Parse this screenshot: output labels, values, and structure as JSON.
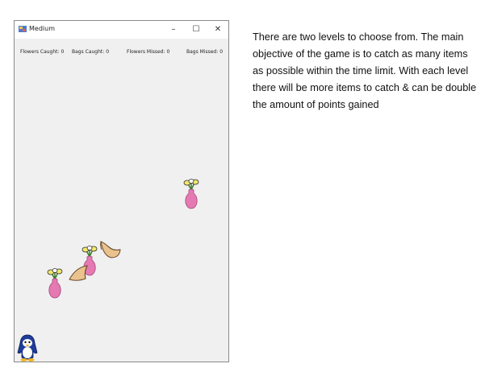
{
  "window": {
    "title": "Medium",
    "controls": {
      "minimize": "–",
      "maximize": "☐",
      "close": "✕"
    }
  },
  "stats": {
    "flowers_caught_label": "Flowers Caught:",
    "flowers_caught_value": "0",
    "bags_caught_label": "Bags Caught:",
    "bags_caught_value": "0",
    "flowers_missed_label": "Flowers Missed:",
    "flowers_missed_value": "0",
    "bags_missed_label": "Bags Missed:",
    "bags_missed_value": "0"
  },
  "game": {
    "items": [
      {
        "kind": "flower-vase-icon"
      },
      {
        "kind": "flower-vase-icon"
      },
      {
        "kind": "flower-vase-icon"
      },
      {
        "kind": "bag-icon"
      },
      {
        "kind": "bag-icon"
      }
    ],
    "player": "penguin-icon"
  },
  "description": "There are two levels to choose from. The main objective of the game is to catch as many items as possible within the time limit. With each level there will be more items to catch & can be double the amount of points gained",
  "colors": {
    "window_bg": "#f0f0f0",
    "titlebar_bg": "#ffffff",
    "vase": "#e57ab3",
    "bag": "#e9c28e",
    "penguin": "#1f3c9a"
  }
}
